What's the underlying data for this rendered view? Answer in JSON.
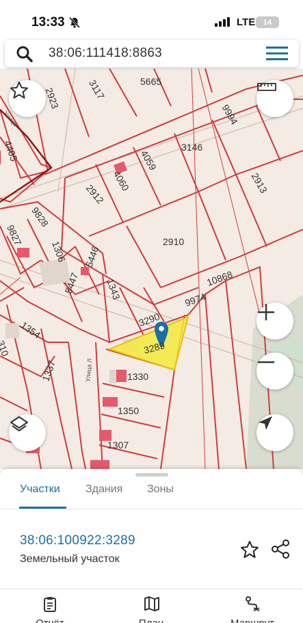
{
  "status": {
    "time": "13:33",
    "network": "LTE",
    "battery": "14"
  },
  "search": {
    "value": "38:06:111418:8863"
  },
  "map": {
    "parcel_labels": [
      "3117",
      "5665",
      "2923",
      "4405",
      "9994",
      "3146",
      "4059",
      "4060",
      "2913",
      "2912",
      "9828",
      "9827",
      "2910",
      "1306",
      "5446",
      "10868",
      "5447",
      "1343",
      "9974",
      "3290",
      "3289",
      "1354",
      "1330",
      "310",
      "1337",
      "1350",
      "1307"
    ],
    "street_label_1": "Улица",
    "street_label_2": "Улица Л"
  },
  "sheet": {
    "tabs": [
      {
        "label": "Участки"
      },
      {
        "label": "Здания"
      },
      {
        "label": "Зоны"
      }
    ],
    "parcel_number": "38:06:100922:3289",
    "parcel_type": "Земельный участок"
  },
  "bottom_nav": [
    {
      "label": "Отчёт",
      "icon": "report-icon"
    },
    {
      "label": "План",
      "icon": "map-plan-icon"
    },
    {
      "label": "Маршрут",
      "icon": "route-icon"
    }
  ],
  "colors": {
    "accent": "#1a6fa5",
    "parcel_border": "#d23a3a",
    "selected_fill": "#f3ea3c",
    "map_bg": "#f3ebe4"
  }
}
